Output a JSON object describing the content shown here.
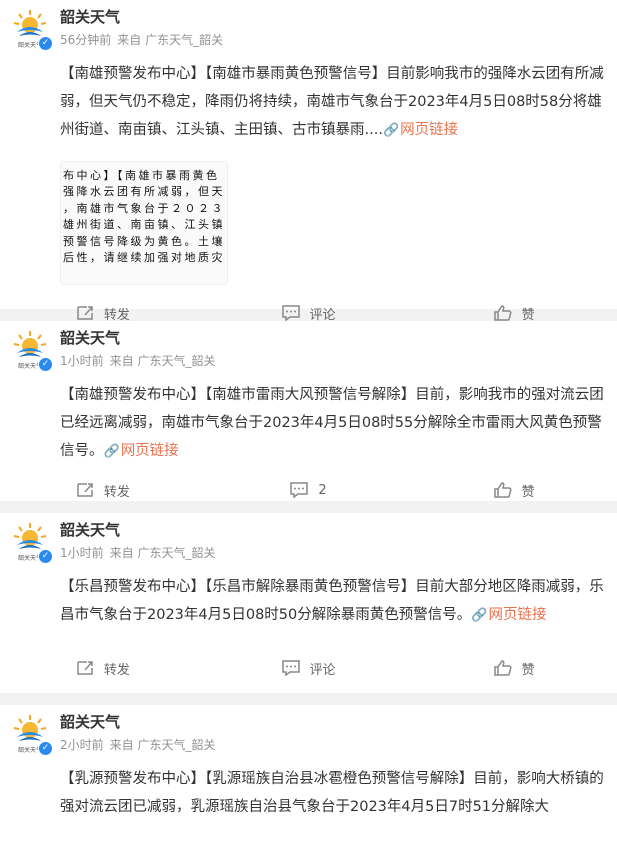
{
  "posts": [
    {
      "username": "韶关天气",
      "avatar_text": "韶关天气",
      "time": "56分钟前",
      "source": "来自 广东天气_韶关",
      "text": "【南雄预警发布中心】【南雄市暴雨黄色预警信号】目前影响我市的强降水云团有所减弱，但天气仍不稳定，降雨仍将持续，南雄市气象台于2023年4月5日08时58分将雄州街道、南亩镇、江头镇、主田镇、古市镇暴雨....",
      "link": "网页链接",
      "thumb_lines": [
        "布中心】【南雄市暴雨黄色",
        "强降水云团有所减弱，但天",
        "，南雄市气象台于２０２３",
        "雄州街道、南亩镇、江头镇",
        "预警信号降级为黄色。土壤",
        "后性，请继续加强对地质灾"
      ],
      "actions": {
        "repost": "转发",
        "comment": "评论",
        "like": "赞"
      }
    },
    {
      "username": "韶关天气",
      "avatar_text": "韶关天气",
      "time": "1小时前",
      "source": "来自 广东天气_韶关",
      "text": "【南雄预警发布中心】【南雄市雷雨大风预警信号解除】目前，影响我市的强对流云团已经远离减弱，南雄市气象台于2023年4月5日08时55分解除全市雷雨大风黄色预警信号。",
      "link": "网页链接",
      "actions": {
        "repost": "转发",
        "comment": "2",
        "like": "赞"
      }
    },
    {
      "username": "韶关天气",
      "avatar_text": "韶关天气",
      "time": "1小时前",
      "source": "来自 广东天气_韶关",
      "text": "【乐昌预警发布中心】【乐昌市解除暴雨黄色预警信号】目前大部分地区降雨减弱，乐昌市气象台于2023年4月5日08时50分解除暴雨黄色预警信号。",
      "link": "网页链接",
      "actions": {
        "repost": "转发",
        "comment": "评论",
        "like": "赞"
      }
    },
    {
      "username": "韶关天气",
      "avatar_text": "韶关天气",
      "time": "2小时前",
      "source": "来自 广东天气_韶关",
      "text": "【乳源预警发布中心】【乳源瑶族自治县冰雹橙色预警信号解除】目前，影响大桥镇的强对流云团已减弱，乳源瑶族自治县气象台于2023年4月5日7时51分解除大"
    }
  ],
  "colors": {
    "link": "#eb7350",
    "verified": "#2a8af0",
    "meta": "#939393"
  }
}
